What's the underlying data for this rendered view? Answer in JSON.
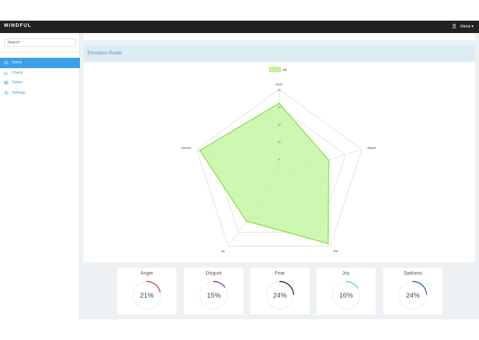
{
  "brand": "MINDFUL",
  "user": {
    "name": "Alexa ▾",
    "icon": "user-icon"
  },
  "search": {
    "placeholder": "Search"
  },
  "sidebar": {
    "items": [
      {
        "label": "Home",
        "icon": "home-icon",
        "active": true
      },
      {
        "label": "Charts",
        "icon": "chart-icon",
        "active": false
      },
      {
        "label": "Tables",
        "icon": "table-icon",
        "active": false
      },
      {
        "label": "Settings",
        "icon": "settings-icon",
        "active": false
      }
    ]
  },
  "panel": {
    "title": "Emotions Radar"
  },
  "chart_data": {
    "type": "radar",
    "legend": "Me",
    "axes": [
      "anger",
      "disgust",
      "fear",
      "joy",
      "sadness"
    ],
    "ticks": [
      5,
      10,
      15,
      20,
      25
    ],
    "max": 25,
    "series": [
      {
        "name": "Me",
        "values": [
          21,
          15,
          24,
          16,
          24
        ]
      }
    ],
    "colors": {
      "fill": "#c6f7a4",
      "stroke": "#8ee24f"
    }
  },
  "stats": [
    {
      "label": "Anger",
      "value": "21%",
      "pct": 21,
      "color": "#d23b3b"
    },
    {
      "label": "Disgust",
      "value": "15%",
      "pct": 15,
      "color": "#7b2cc4"
    },
    {
      "label": "Fear",
      "value": "24%",
      "pct": 24,
      "color": "#222222"
    },
    {
      "label": "Joy",
      "value": "16%",
      "pct": 16,
      "color": "#54e37f"
    },
    {
      "label": "Sadness",
      "value": "24%",
      "pct": 24,
      "color": "#1f5fc2"
    }
  ]
}
